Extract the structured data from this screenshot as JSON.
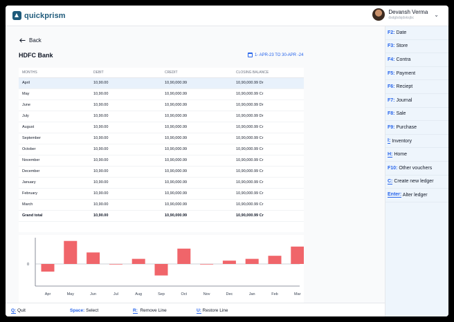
{
  "app": {
    "name": "quickprism"
  },
  "user": {
    "name": "Devansh Verma",
    "subtitle": "dsdgbdsjdsksjbc"
  },
  "back_label": "Back",
  "page_title": "HDFC Bank",
  "date_range": "1- APR-23 TO 30-APR -24",
  "table": {
    "headers": [
      "MONTHS",
      "DEBIT",
      "CREDIT",
      "CLOSING BALANCE"
    ],
    "rows": [
      [
        "April",
        "10,90.00",
        "10,90,000.99",
        "10,90,000.99 Dr"
      ],
      [
        "May",
        "10,90.00",
        "10,90,000.99",
        "10,90,000.99 Cr"
      ],
      [
        "June",
        "10,90.00",
        "10,90,000.99",
        "10,90,000.99 Dr"
      ],
      [
        "July",
        "10,90.00",
        "10,90,000.99",
        "10,90,000.99 Dr"
      ],
      [
        "August",
        "10,90.00",
        "10,90,000.99",
        "10,90,000.99 Cr"
      ],
      [
        "September",
        "10,90.00",
        "10,90,000.99",
        "10,90,000.99 Cr"
      ],
      [
        "October",
        "10,90.00",
        "10,90,000.99",
        "10,90,000.99 Cr"
      ],
      [
        "November",
        "10,90.00",
        "10,90,000.99",
        "10,90,000.99 Cr"
      ],
      [
        "December",
        "10,90.00",
        "10,90,000.99",
        "10,90,000.99 Cr"
      ],
      [
        "January",
        "10,90.00",
        "10,90,000.99",
        "10,90,000.99 Cr"
      ],
      [
        "February",
        "10,90.00",
        "10,90,000.99",
        "10,90,000.99 Cr"
      ],
      [
        "March",
        "10,90.00",
        "10,90,000.99",
        "10,90,000.99 Cr"
      ]
    ],
    "total": [
      "Grand total",
      "10,90.00",
      "10,90,000.99",
      "10,90,000.99 Cr"
    ]
  },
  "chart_data": {
    "type": "bar",
    "categories": [
      "Apr",
      "May",
      "Jun",
      "Jul",
      "Aug",
      "Sep",
      "Oct",
      "Nov",
      "Dec",
      "Jan",
      "Feb",
      "Mar"
    ],
    "values": [
      -3,
      9,
      4.5,
      -0.2,
      2,
      -4.5,
      6,
      -0.2,
      1.3,
      2,
      3.2,
      6.8
    ],
    "ytick_label": "0",
    "bar_color": "#f0656a"
  },
  "sidebar": [
    {
      "key": "F2:",
      "label": " Date",
      "ul": false
    },
    {
      "key": "F3:",
      "label": " Store",
      "ul": false
    },
    {
      "key": "F4:",
      "label": " Contra",
      "ul": false
    },
    {
      "key": "F5:",
      "label": " Payment",
      "ul": false
    },
    {
      "key": "F6:",
      "label": " Reciept",
      "ul": false
    },
    {
      "key": "F7:",
      "label": " Journal",
      "ul": false
    },
    {
      "key": "F8:",
      "label": " Sale",
      "ul": false
    },
    {
      "key": "F9:",
      "label": " Purchase",
      "ul": false
    },
    {
      "key": "I:",
      "label": " Inventory",
      "ul": true
    },
    {
      "key": "H:",
      "label": " Home",
      "ul": true
    },
    {
      "key": "F10:",
      "label": " Other vouchers",
      "ul": false
    },
    {
      "key": "C:",
      "label": " Create new ledger",
      "ul": true
    },
    {
      "key": "Enter:",
      "label": " Alter ledger",
      "ul": true
    }
  ],
  "footer": [
    {
      "key": "Q:",
      "label": " Quit"
    },
    {
      "key": "Space:",
      "label": " Select"
    },
    {
      "key": "R:",
      "label": "  Remove Line"
    },
    {
      "key": "U:",
      "label": " Restore Line"
    }
  ]
}
